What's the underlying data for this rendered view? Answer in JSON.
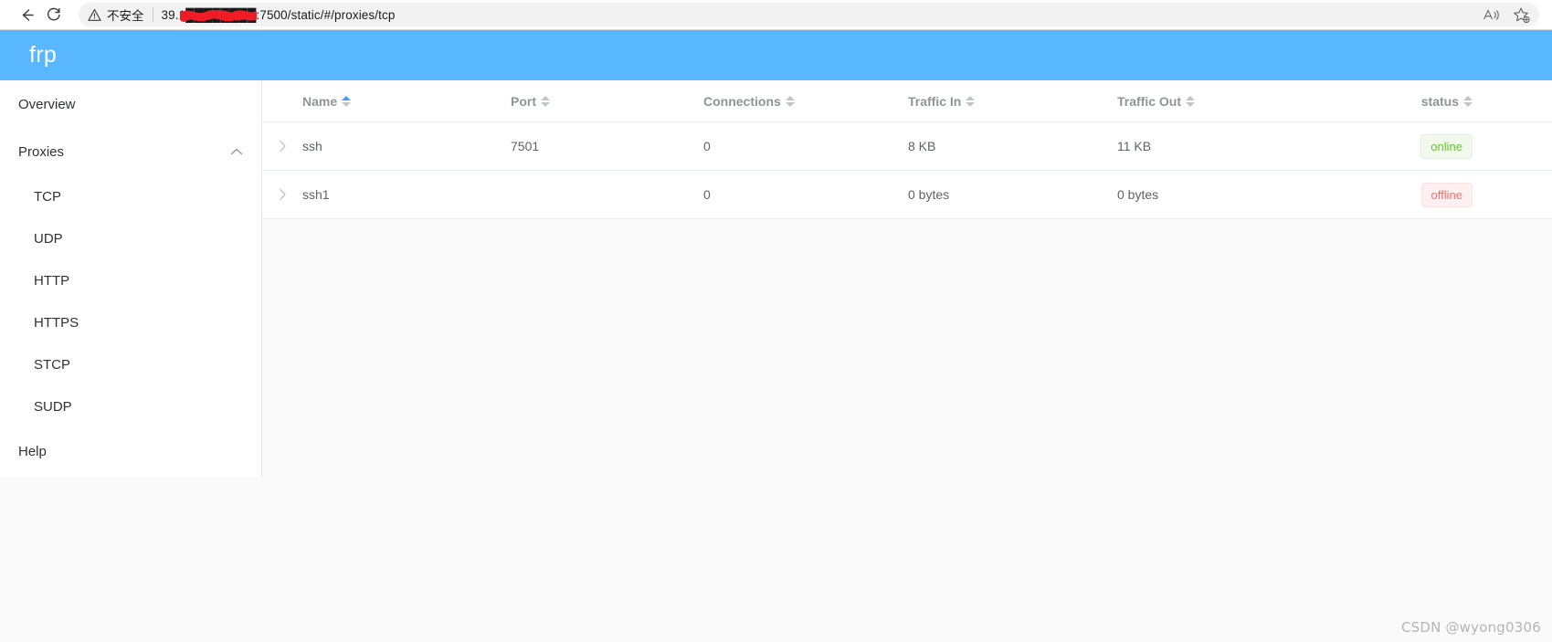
{
  "browser": {
    "back_label": "back-arrow",
    "reload_label": "reload",
    "security_text": "不安全",
    "url": "39.1████████:7500/static/#/proxies/tcp",
    "url_prefix": "39.1",
    "url_suffix": ":7500/static/#/proxies/tcp",
    "read_aloud_label": "Read aloud",
    "favorites_label": "Add to favorites",
    "redaction_color": "#ee1c25"
  },
  "app": {
    "brand": "frp",
    "header_color": "#58b7ff"
  },
  "sidebar": {
    "items": [
      {
        "label": "Overview",
        "type": "item"
      },
      {
        "label": "Proxies",
        "type": "group",
        "expanded": true
      },
      {
        "label": "TCP",
        "type": "sub",
        "active": true
      },
      {
        "label": "UDP",
        "type": "sub"
      },
      {
        "label": "HTTP",
        "type": "sub"
      },
      {
        "label": "HTTPS",
        "type": "sub"
      },
      {
        "label": "STCP",
        "type": "sub"
      },
      {
        "label": "SUDP",
        "type": "sub"
      },
      {
        "label": "Help",
        "type": "item"
      }
    ]
  },
  "table": {
    "columns": [
      {
        "label": "Name",
        "sorted": "asc"
      },
      {
        "label": "Port",
        "sorted": "none"
      },
      {
        "label": "Connections",
        "sorted": "none"
      },
      {
        "label": "Traffic In",
        "sorted": "none"
      },
      {
        "label": "Traffic Out",
        "sorted": "none"
      },
      {
        "label": "status",
        "sorted": "none"
      }
    ],
    "rows": [
      {
        "name": "ssh",
        "port": "7501",
        "connections": "0",
        "traffic_in": "8 KB",
        "traffic_out": "11 KB",
        "status": "online"
      },
      {
        "name": "ssh1",
        "port": "",
        "connections": "0",
        "traffic_in": "0 bytes",
        "traffic_out": "0 bytes",
        "status": "offline"
      }
    ]
  },
  "watermark": "CSDN @wyong0306",
  "colors": {
    "online_bg": "#f0f9eb",
    "online_text": "#67c23a",
    "offline_bg": "#fef0f0",
    "offline_text": "#f56c6c",
    "accent": "#409eff"
  }
}
